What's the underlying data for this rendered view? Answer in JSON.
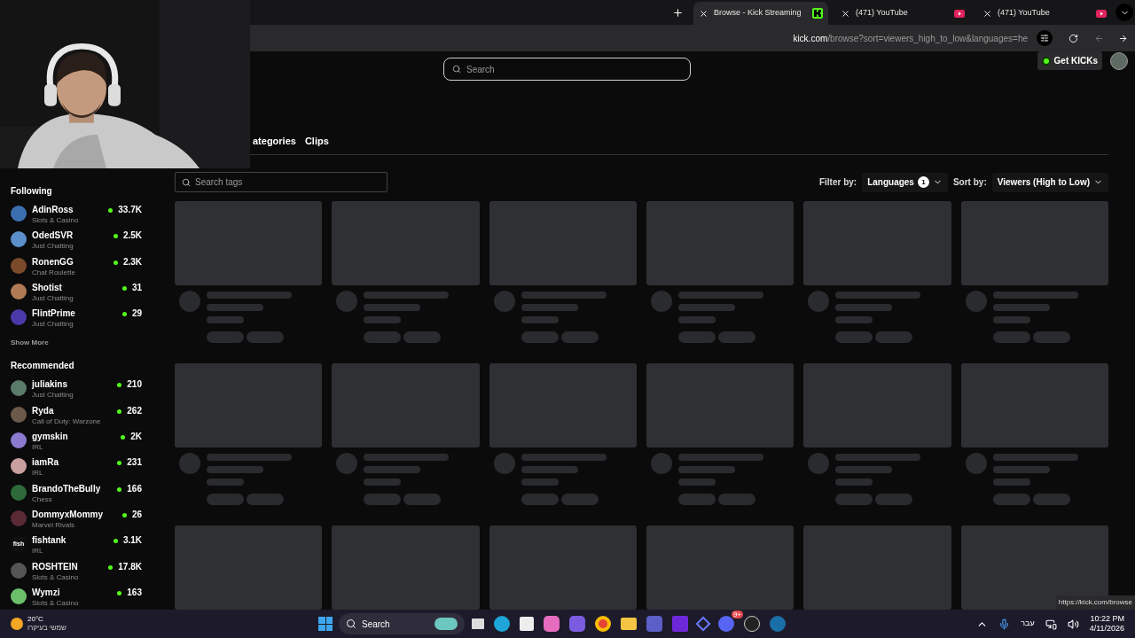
{
  "browser": {
    "tabs": [
      {
        "title": "Browse - Kick Streaming",
        "kind": "kick",
        "selected": true
      },
      {
        "title": "(471) YouTube",
        "kind": "youtube",
        "selected": false
      },
      {
        "title": "(471) YouTube",
        "kind": "youtube",
        "selected": false
      }
    ],
    "url_host": "kick.com",
    "url_path": "/browse?sort=viewers_high_to_low&languages=he",
    "status_link": "https://kick.com/browse"
  },
  "header": {
    "search_placeholder": "Search",
    "get_kicks": "Get KICKs"
  },
  "sidebar": {
    "sections": [
      {
        "title": "Following",
        "channels": [
          {
            "name": "AdinRoss",
            "category": "Slots & Casino",
            "viewers": "33.7K",
            "color": "#3b6fb0"
          },
          {
            "name": "OdedSVR",
            "category": "Just Chatting",
            "viewers": "2.5K",
            "color": "#5b8fc9"
          },
          {
            "name": "RonenGG",
            "category": "Chat Roulette",
            "viewers": "2.3K",
            "color": "#7a4a2a"
          },
          {
            "name": "Shotist",
            "category": "Just Chatting",
            "viewers": "31",
            "color": "#b07a55"
          },
          {
            "name": "FlintPrime",
            "category": "Just Chatting",
            "viewers": "29",
            "color": "#4a3aa8"
          }
        ],
        "more": "Show More"
      },
      {
        "title": "Recommended",
        "channels": [
          {
            "name": "juliakins",
            "category": "Just Chatting",
            "viewers": "210",
            "color": "#5a7a6a"
          },
          {
            "name": "Ryda",
            "category": "Call of Duty: Warzone",
            "viewers": "262",
            "color": "#6b5a4a"
          },
          {
            "name": "gymskin",
            "category": "IRL",
            "viewers": "2K",
            "color": "#8a7ad0"
          },
          {
            "name": "iamRa",
            "category": "IRL",
            "viewers": "231",
            "color": "#c9a0a0"
          },
          {
            "name": "BrandoTheBully",
            "category": "Chess",
            "viewers": "166",
            "color": "#2f6b3a"
          },
          {
            "name": "DommyxMommy",
            "category": "Marvel Rivals",
            "viewers": "26",
            "color": "#5a2a35"
          },
          {
            "name": "fishtank",
            "category": "IRL",
            "viewers": "3.1K",
            "color": "#111111",
            "logo": "fish"
          },
          {
            "name": "ROSHTEIN",
            "category": "Slots & Casino",
            "viewers": "17.8K",
            "color": "#555555"
          },
          {
            "name": "Wymzi",
            "category": "Slots & Casino",
            "viewers": "163",
            "color": "#6bbf6b"
          }
        ]
      }
    ]
  },
  "browse": {
    "tabs": [
      {
        "label": "ategories",
        "selected": false
      },
      {
        "label": "Clips",
        "selected": false
      }
    ],
    "tags_placeholder": "Search tags",
    "filter_label": "Filter by:",
    "filter_value": "Languages",
    "filter_count": "1",
    "sort_label": "Sort by:",
    "sort_value": "Viewers (High to Low)"
  },
  "taskbar": {
    "temperature": "20°C",
    "weather": "שמשי בעיקרו",
    "search": "Search",
    "language": "עבר",
    "time": "10:22 PM",
    "date": "4/11/2026",
    "discord_badge": "9+"
  }
}
